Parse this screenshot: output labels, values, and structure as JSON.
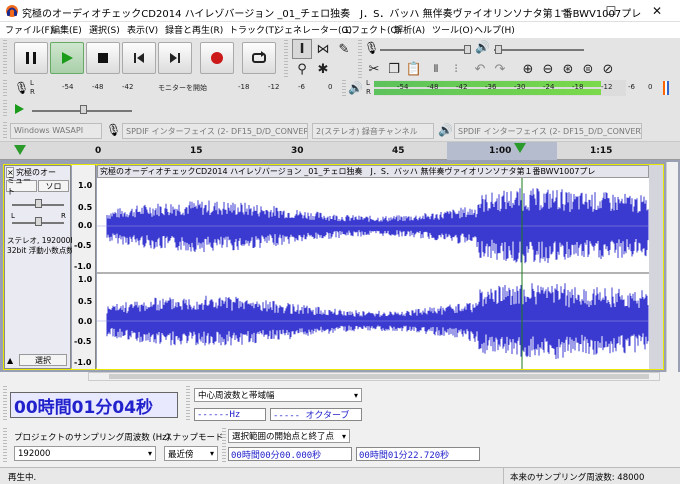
{
  "window": {
    "title": "究極のオーディオチェックCD2014 ハイレゾバージョン _01_チェロ独奏　J．S．バッハ 無伴奏ヴァイオリンソナタ第１番BWV1007プレ",
    "minimize_icon": "minimize-icon",
    "maximize_icon": "maximize-icon",
    "close_icon": "close-icon"
  },
  "menu": [
    "ファイル(F)",
    "編集(E)",
    "選択(S)",
    "表示(V)",
    "録音と再生(R)",
    "トラック(T)",
    "ジェネレーター(G)",
    "エフェクト(C)",
    "解析(A)",
    "ツール(O)",
    "ヘルプ(H)"
  ],
  "transport": {
    "pause": "pause-icon",
    "play": "play-icon",
    "stop": "stop-icon",
    "skip_start": "skip-start-icon",
    "skip_end": "skip-end-icon",
    "record": "record-icon",
    "loop": "loop-icon"
  },
  "tools": {
    "selection": "I-beam-icon",
    "envelope": "envelope-icon",
    "draw": "pencil-icon",
    "zoom": "zoom-icon",
    "multi": "multi-tool-icon"
  },
  "rec_meter": {
    "lr": [
      "L",
      "R"
    ],
    "scale": [
      "-54",
      "-48",
      "-42",
      "モニターを開始",
      "-18",
      "-12",
      "-6",
      "0"
    ]
  },
  "play_meter": {
    "lr": [
      "L",
      "R"
    ],
    "scale": [
      "-54",
      "-48",
      "-42",
      "-36",
      "-30",
      "-24",
      "-18",
      "-12",
      "-6",
      "0"
    ],
    "level": 0.9
  },
  "devices": {
    "host": "Windows WASAPI",
    "rec_device": "SPDIF インターフェイス (2- DF15_D/D_CONVERTI",
    "channels": "2(ステレオ) 録音チャンネル",
    "play_device": "SPDIF インターフェイス (2- DF15_D/D_CONVERTI"
  },
  "ruler": {
    "labels": [
      "0",
      "15",
      "30",
      "45",
      "1:00",
      "1:15"
    ]
  },
  "track": {
    "name": "究極のオー",
    "mute": "ミュート",
    "solo": "ソロ",
    "lr": [
      "L",
      "R"
    ],
    "info1": "ステレオ, 192000Hz",
    "info2": "32bit 浮動小数点数",
    "select": "選択",
    "collapse_icon": "collapse-icon",
    "clip_title": "究極のオーディオチェックCD2014 ハイレゾバージョン _01_チェロ独奏　J．S．バッハ 無伴奏ヴァイオリンソナタ第１番BWV1007プレ",
    "scale_top": [
      "1.0",
      "0.5",
      "0.0",
      "-0.5",
      "-1.0"
    ],
    "scale_bot": [
      "1.0",
      "0.5",
      "0.0",
      "-0.5",
      "-1.0"
    ]
  },
  "bottom": {
    "time": "00時間01分04秒",
    "freq_band": "中心周波数と帯域幅",
    "hz_field": "------Hz",
    "octave_field": "----- オクターブ",
    "project_rate_label": "プロジェクトのサンプリング周波数 (Hz)",
    "snap_label": "スナップモード",
    "selection_label": "選択範囲の開始点と終了点",
    "project_rate": "192000",
    "snap": "最近傍",
    "sel_start": "00時間00分00.000秒",
    "sel_end": "00時間01分22.720秒"
  },
  "status": {
    "left": "再生中.",
    "right": "本来のサンプリング周波数: 48000"
  }
}
